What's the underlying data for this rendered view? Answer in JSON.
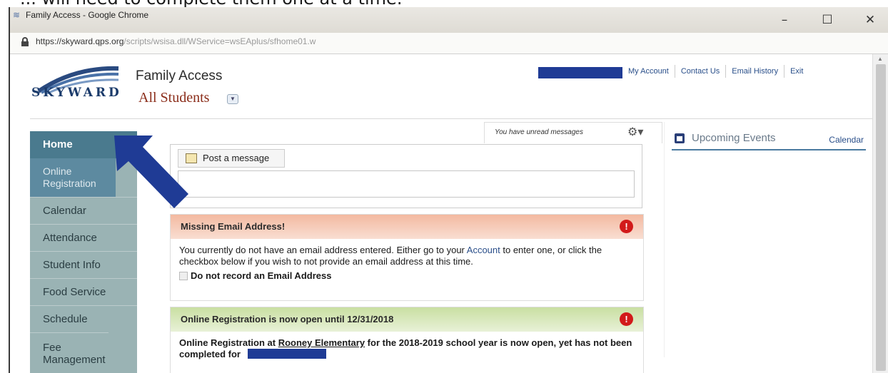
{
  "caption": "... will need to complete them one at a time.",
  "browser": {
    "window_title": "Family Access - Google Chrome",
    "url_domain": "https://skyward.qps.org",
    "url_path": "/scripts/wsisa.dll/WService=wsEAplus/sfhome01.w",
    "controls": {
      "minimize": "–",
      "maximize": "☐",
      "close": "✕"
    }
  },
  "header": {
    "logo_text": "SKYWARD",
    "app_title": "Family Access",
    "student_selector": "All Students",
    "top_links": [
      "My Account",
      "Contact Us",
      "Email History",
      "Exit"
    ]
  },
  "nav": {
    "items": [
      {
        "label": "Home"
      },
      {
        "label": "Online Registration"
      },
      {
        "label": "Calendar"
      },
      {
        "label": "Attendance"
      },
      {
        "label": "Student Info"
      },
      {
        "label": "Food Service"
      },
      {
        "label": "Schedule"
      },
      {
        "label": "Fee Management"
      }
    ]
  },
  "messages": {
    "unread_text": "You have unread messages",
    "post_tab_label": "Post a message"
  },
  "alerts": [
    {
      "title": "Missing Email Address!",
      "body_part1": "You currently do not have an email address entered. Either go to your ",
      "body_link": "Account",
      "body_part2": " to enter one, or click the checkbox below if you wish to not provide an email address at this time.",
      "checkbox_label": "Do not record an Email Address",
      "icon": "!"
    },
    {
      "title": "Online Registration is now open until 12/31/2018",
      "body_part1": "Online Registration at ",
      "body_link": "Rooney Elementary",
      "body_part2": " for the 2018-2019 school year is now open, yet has not been completed for",
      "icon": "!"
    }
  ],
  "right_panel": {
    "title": "Upcoming Events",
    "calendar_link": "Calendar"
  },
  "colors": {
    "nav_bg": "#9ab3b4",
    "nav_active": "#4a7a8e",
    "redaction": "#1f3b95",
    "annotation_arrow": "#1f3b95",
    "alert_red": "#d21a1a"
  }
}
